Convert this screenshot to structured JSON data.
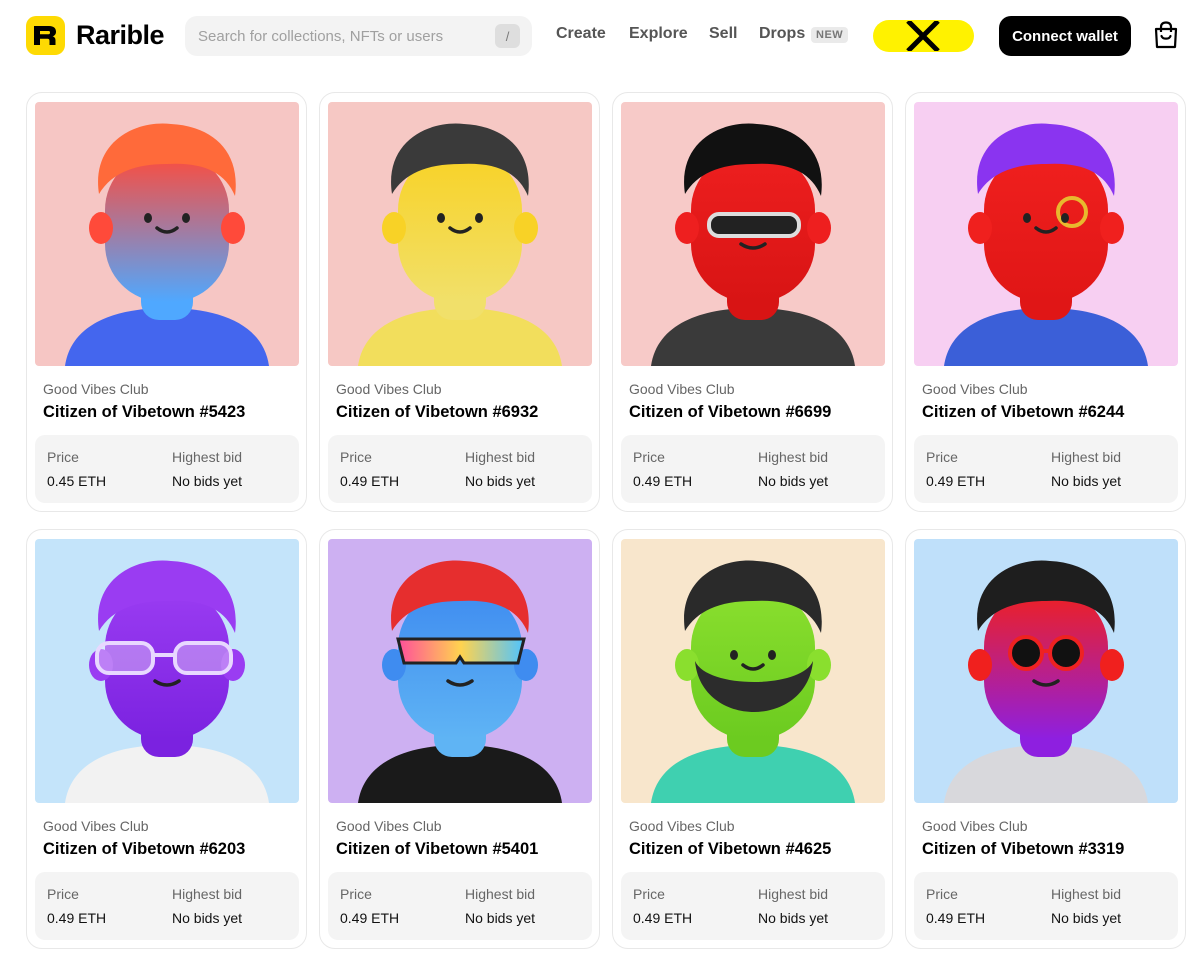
{
  "header": {
    "brand": "Rarible",
    "search_placeholder": "Search for collections, NFTs or users",
    "search_shortcut": "/",
    "nav": {
      "create": "Create",
      "explore": "Explore",
      "sell": "Sell",
      "drops": "Drops",
      "drops_badge": "NEW"
    },
    "connect_label": "Connect wallet",
    "brand_color": "#FEDA03",
    "x_promo_color": "#FFF200"
  },
  "price_label": "Price",
  "bid_label": "Highest bid",
  "cards": [
    {
      "collection": "Good Vibes Club",
      "title": "Citizen of Vibetown #5423",
      "price": "0.45 ETH",
      "bid": "No bids yet",
      "bg": "#F6C6C4",
      "skin_top": "#FF4A3A",
      "skin_bottom": "#4FA8FF",
      "hair": "#FF6A3A",
      "shirt": "#4466EE",
      "accessory": "none"
    },
    {
      "collection": "Good Vibes Club",
      "title": "Citizen of Vibetown #6932",
      "price": "0.49 ETH",
      "bid": "No bids yet",
      "bg": "#F6C8C4",
      "skin_top": "#F8D226",
      "skin_bottom": "#F1E06A",
      "hair": "#3A3A3A",
      "shirt": "#F2DE5C",
      "accessory": "none"
    },
    {
      "collection": "Good Vibes Club",
      "title": "Citizen of Vibetown #6699",
      "price": "0.49 ETH",
      "bid": "No bids yet",
      "bg": "#F7CAC8",
      "skin_top": "#EE1F1F",
      "skin_bottom": "#D81414",
      "hair": "#111111",
      "shirt": "#3A3A3A",
      "accessory": "visor"
    },
    {
      "collection": "Good Vibes Club",
      "title": "Citizen of Vibetown #6244",
      "price": "0.49 ETH",
      "bid": "No bids yet",
      "bg": "#F7CFF2",
      "skin_top": "#F0201E",
      "skin_bottom": "#E01616",
      "hair": "#8A34F0",
      "shirt": "#3B5FD8",
      "accessory": "monocle"
    },
    {
      "collection": "Good Vibes Club",
      "title": "Citizen of Vibetown #6203",
      "price": "0.49 ETH",
      "bid": "No bids yet",
      "bg": "#C4E4FA",
      "skin_top": "#9A3CF2",
      "skin_bottom": "#7B22E0",
      "hair": "#9A3CF2",
      "shirt": "#F2F2F2",
      "accessory": "glasses"
    },
    {
      "collection": "Good Vibes Club",
      "title": "Citizen of Vibetown #5401",
      "price": "0.49 ETH",
      "bid": "No bids yet",
      "bg": "#CDB0F2",
      "skin_top": "#3F8CF0",
      "skin_bottom": "#5FB4F4",
      "hair": "#E62E2E",
      "shirt": "#1A1A1A",
      "accessory": "visor-rainbow"
    },
    {
      "collection": "Good Vibes Club",
      "title": "Citizen of Vibetown #4625",
      "price": "0.49 ETH",
      "bid": "No bids yet",
      "bg": "#F8E6CC",
      "skin_top": "#8ADF2E",
      "skin_bottom": "#6CCB20",
      "hair": "#2A2A2A",
      "shirt": "#3FD0B0",
      "accessory": "beard"
    },
    {
      "collection": "Good Vibes Club",
      "title": "Citizen of Vibetown #3319",
      "price": "0.49 ETH",
      "bid": "No bids yet",
      "bg": "#BFE0FA",
      "skin_top": "#F0201E",
      "skin_bottom": "#8E1FE0",
      "hair": "#1E1E1E",
      "shirt": "#D8D8DC",
      "accessory": "sunglasses"
    }
  ]
}
